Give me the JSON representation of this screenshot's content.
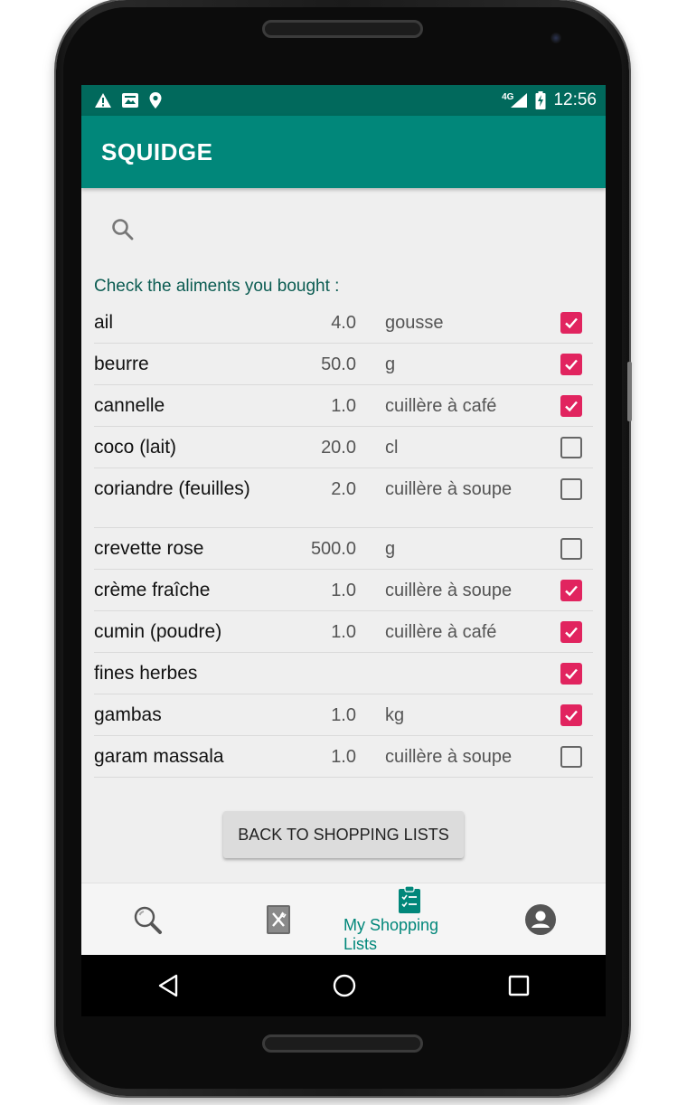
{
  "status_bar": {
    "network": "4G",
    "time": "12:56"
  },
  "app": {
    "title": "SQUIDGE"
  },
  "instruction": "Check the aliments you bought :",
  "items": [
    {
      "name": "ail",
      "qty": "4.0",
      "unit": "gousse",
      "checked": true
    },
    {
      "name": "beurre",
      "qty": "50.0",
      "unit": "g",
      "checked": true
    },
    {
      "name": "cannelle",
      "qty": "1.0",
      "unit": "cuillère à café",
      "checked": true
    },
    {
      "name": "coco (lait)",
      "qty": "20.0",
      "unit": "cl",
      "checked": false
    },
    {
      "name": "coriandre (feuilles)",
      "qty": "2.0",
      "unit": "cuillère à soupe",
      "checked": false
    },
    {
      "name": "crevette rose",
      "qty": "500.0",
      "unit": "g",
      "checked": false
    },
    {
      "name": "crème fraîche",
      "qty": "1.0",
      "unit": "cuillère à soupe",
      "checked": true
    },
    {
      "name": "cumin (poudre)",
      "qty": "1.0",
      "unit": "cuillère à café",
      "checked": true
    },
    {
      "name": "fines herbes",
      "qty": "",
      "unit": "",
      "checked": true
    },
    {
      "name": "gambas",
      "qty": "1.0",
      "unit": "kg",
      "checked": true
    },
    {
      "name": "garam massala",
      "qty": "1.0",
      "unit": "cuillère à soupe",
      "checked": false
    }
  ],
  "back_button": "BACK TO SHOPPING LISTS",
  "bottom_nav": [
    {
      "icon": "search-icon",
      "label": ""
    },
    {
      "icon": "recipe-book-icon",
      "label": ""
    },
    {
      "icon": "clipboard-checklist-icon",
      "label": "My Shopping Lists",
      "active": true
    },
    {
      "icon": "account-icon",
      "label": ""
    }
  ],
  "colors": {
    "primary": "#01877a",
    "primary_dark": "#01695c",
    "accent": "#e1245f",
    "screen_bg": "#efefef"
  }
}
